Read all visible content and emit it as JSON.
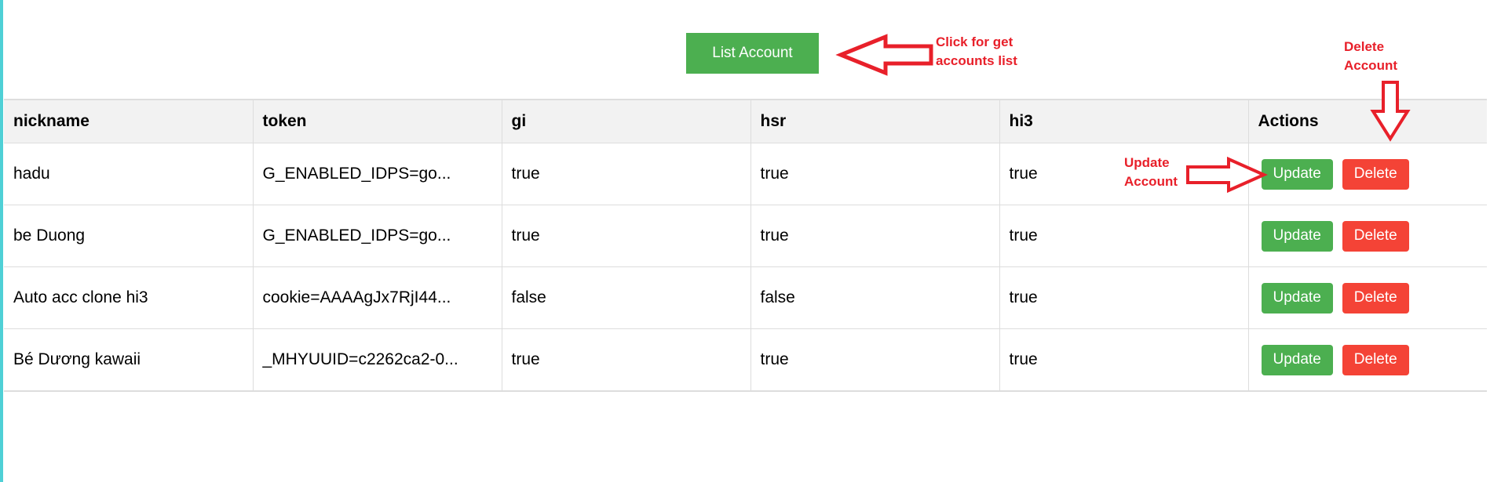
{
  "toolbar": {
    "list_label": "List Account"
  },
  "table": {
    "headers": [
      "nickname",
      "token",
      "gi",
      "hsr",
      "hi3",
      "Actions"
    ],
    "rows": [
      {
        "nickname": "hadu",
        "token": "G_ENABLED_IDPS=go...",
        "gi": "true",
        "hsr": "true",
        "hi3": "true"
      },
      {
        "nickname": "be Duong",
        "token": "G_ENABLED_IDPS=go...",
        "gi": "true",
        "hsr": "true",
        "hi3": "true"
      },
      {
        "nickname": "Auto acc clone hi3",
        "token": "cookie=AAAAgJx7RjI44...",
        "gi": "false",
        "hsr": "false",
        "hi3": "true"
      },
      {
        "nickname": "Bé Dương kawaii",
        "token": "_MHYUUID=c2262ca2-0...",
        "gi": "true",
        "hsr": "true",
        "hi3": "true"
      }
    ],
    "update_label": "Update",
    "delete_label": "Delete"
  },
  "annotations": {
    "list_hint": [
      "Click for get",
      "accounts list"
    ],
    "delete_hint": [
      "Delete",
      "Account"
    ],
    "update_hint": [
      "Update",
      "Account"
    ]
  },
  "colors": {
    "accent_green": "#4caf50",
    "danger_red": "#f44336",
    "annotation_red": "#e8202a"
  }
}
